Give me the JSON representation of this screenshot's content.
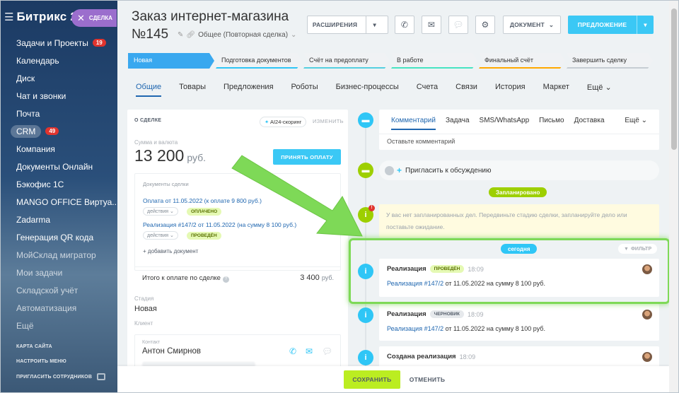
{
  "sidebar": {
    "brand": "Битрикс 24",
    "items": [
      {
        "label": "Задачи и Проекты",
        "badge": "19"
      },
      {
        "label": "Календарь"
      },
      {
        "label": "Диск"
      },
      {
        "label": "Чат и звонки"
      },
      {
        "label": "Почта"
      },
      {
        "label": "CRM",
        "badge": "49"
      },
      {
        "label": "Компания"
      },
      {
        "label": "Документы Онлайн"
      },
      {
        "label": "Бэкофис 1С"
      },
      {
        "label": "MANGO OFFICE Виртуа..."
      },
      {
        "label": "Zadarma"
      },
      {
        "label": "Генерация QR кода"
      },
      {
        "label": "МойСклад мигратор"
      },
      {
        "label": "Мои задачи"
      },
      {
        "label": "Складской учёт"
      },
      {
        "label": "Автоматизация"
      },
      {
        "label": "Ещё"
      }
    ],
    "bottom": [
      "КАРТА САЙТА",
      "НАСТРОИТЬ МЕНЮ",
      "ПРИГЛАСИТЬ СОТРУДНИКОВ"
    ]
  },
  "deal_pill": "СДЕЛКА",
  "header": {
    "title": "Заказ интернет-магазина",
    "number": "№145",
    "category": "Общее (Повторная сделка)",
    "btn_extensions": "РАСШИРЕНИЯ",
    "btn_document": "ДОКУМЕНТ",
    "btn_offer": "ПРЕДЛОЖЕНИЕ"
  },
  "stages": [
    {
      "label": "Новая",
      "bg": "#39a8ef",
      "color": "#ffffff",
      "line": "#39a8ef"
    },
    {
      "label": "Подготовка документов",
      "bg": "#f0f2f4",
      "color": "#333333",
      "line": "#2fc6f6"
    },
    {
      "label": "Счёт на предоплату",
      "bg": "#f0f2f4",
      "color": "#333333",
      "line": "#55d0e0"
    },
    {
      "label": "В работе",
      "bg": "#f0f2f4",
      "color": "#333333",
      "line": "#47e4c2"
    },
    {
      "label": "Финальный счёт",
      "bg": "#f0f2f4",
      "color": "#333333",
      "line": "#ffa900"
    },
    {
      "label": "Завершить сделку",
      "bg": "#f0f2f4",
      "color": "#333333",
      "line": "#c6cdd3"
    }
  ],
  "tabs": [
    "Общие",
    "Товары",
    "Предложения",
    "Роботы",
    "Бизнес-процессы",
    "Счета",
    "Связи",
    "История",
    "Маркет",
    "Ещё"
  ],
  "deal": {
    "header": "О СДЕЛКЕ",
    "ai_scoring": "AI24-скоринг",
    "change": "ИЗМЕНИТЬ",
    "amount_label": "Сумма и валюта",
    "amount": "13 200",
    "currency": "руб.",
    "pay_btn": "ПРИНЯТЬ ОПЛАТУ",
    "docs_header": "Документы сделки",
    "docs": [
      {
        "link": "Оплата от 11.05.2022 (к оплате 9 800 руб.)",
        "action": "действия",
        "status": "ОПЛАЧЕНО"
      },
      {
        "link": "Реализация #147/2 от 11.05.2022 (на сумму 8 100 руб.)",
        "action": "действия",
        "status": "ПРОВЕДЁН"
      }
    ],
    "add_doc": "+ добавить документ",
    "total_label": "Итого к оплате по сделке",
    "total_value": "3 400",
    "total_currency": "руб.",
    "stage_label": "Стадия",
    "stage_value": "Новая",
    "client_label": "Клиент",
    "contact_label": "Контакт",
    "contact_name": "Антон Смирнов"
  },
  "timeline": {
    "tabs": [
      "Комментарий",
      "Задача",
      "SMS/WhatsApp",
      "Письмо",
      "Доставка"
    ],
    "more": "Ещё",
    "placeholder": "Оставьте комментарий",
    "invite": "Пригласить к обсуждению",
    "planned": "Запланировано",
    "planned_text": "У вас нет запланированных дел. Передвиньте стадию сделки, запланируйте дело или поставьте ожидание.",
    "planned_badge": "!",
    "today": "сегодня",
    "filter": "ФИЛЬТР",
    "events": [
      {
        "title": "Реализация",
        "status": "ПРОВЕДЁН",
        "time": "18:09",
        "link": "Реализация #147/2",
        "text": " от 11.05.2022 на сумму 8 100 руб."
      },
      {
        "title": "Реализация",
        "status": "ЧЕРНОВИК",
        "time": "18:09",
        "link": "Реализация #147/2",
        "text": " от 11.05.2022 на сумму 8 100 руб."
      },
      {
        "title": "Создана реализация",
        "time": "18:09"
      }
    ]
  },
  "footer": {
    "save": "СОХРАНИТЬ",
    "cancel": "ОТМЕНИТЬ"
  }
}
